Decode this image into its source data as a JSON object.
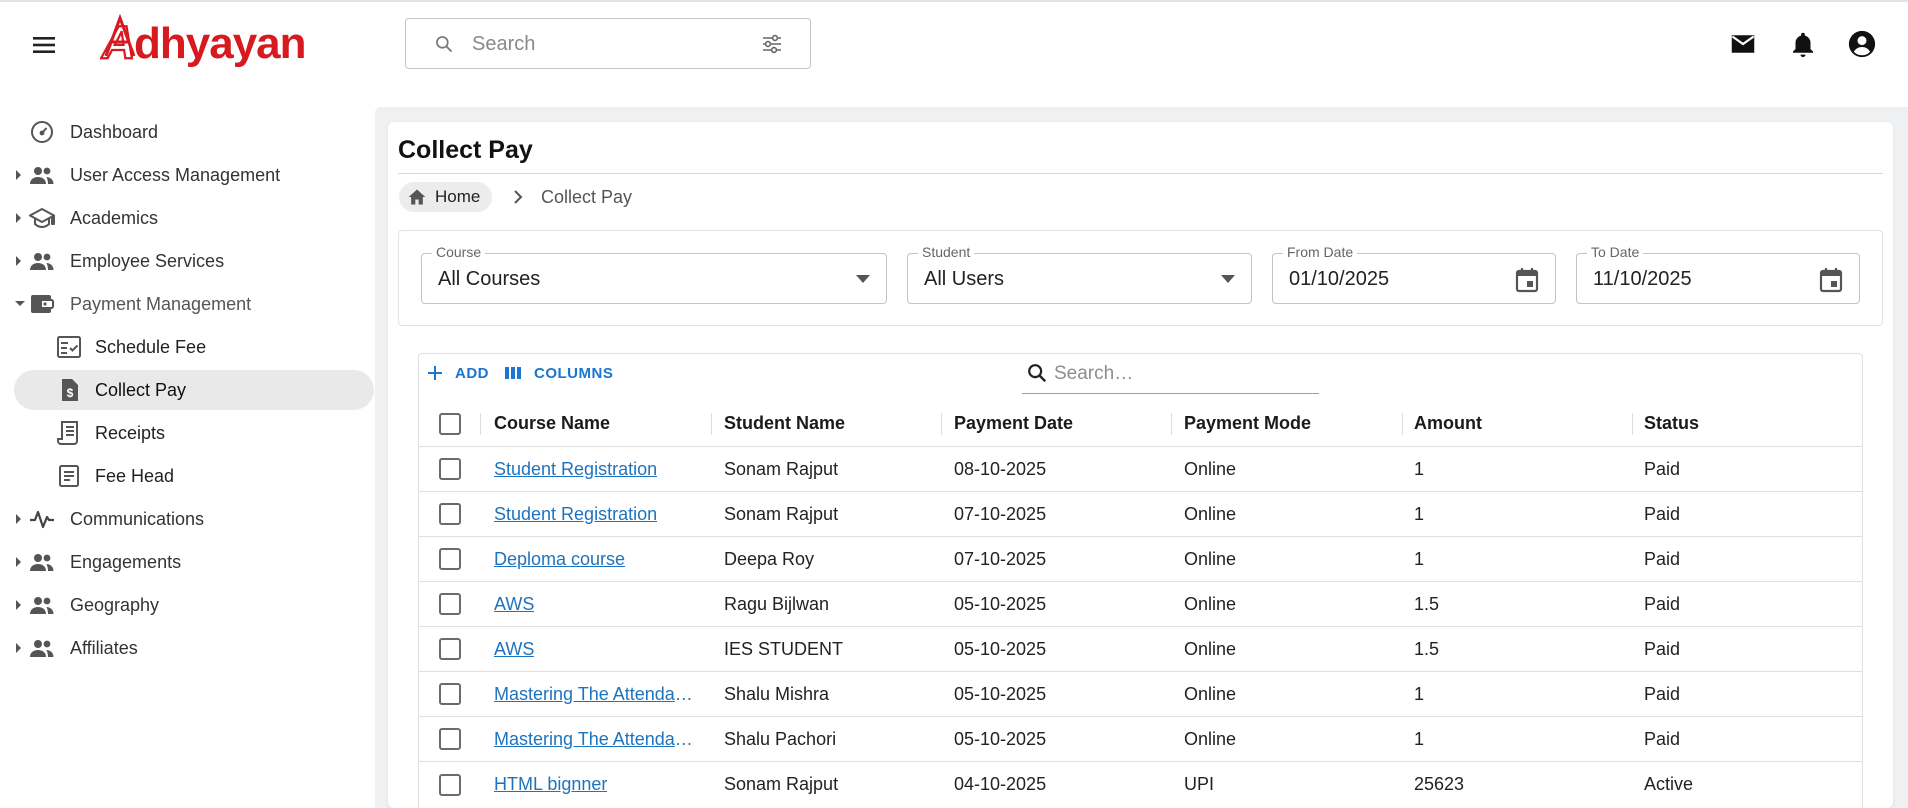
{
  "app": {
    "logo_text": "Adhyayan",
    "brand_color": "#d71920"
  },
  "topbar": {
    "search": {
      "placeholder": "Search"
    },
    "icons": [
      "menu-icon",
      "search-icon",
      "tune-icon",
      "mail-icon",
      "bell-icon",
      "account-icon"
    ]
  },
  "sidebar": {
    "items": [
      {
        "label": "Dashboard",
        "icon": "dashboard-icon",
        "expandable": false
      },
      {
        "label": "User Access Management",
        "icon": "people-icon",
        "expandable": true
      },
      {
        "label": "Academics",
        "icon": "school-icon",
        "expandable": true
      },
      {
        "label": "Employee Services",
        "icon": "people-icon",
        "expandable": true
      },
      {
        "label": "Payment Management",
        "icon": "wallet-icon",
        "expandable": true,
        "expanded": true
      },
      {
        "label": "Schedule Fee",
        "icon": "checklist-icon",
        "sub": true
      },
      {
        "label": "Collect Pay",
        "icon": "invoice-icon",
        "sub": true,
        "active": true
      },
      {
        "label": "Receipts",
        "icon": "receipt-icon",
        "sub": true
      },
      {
        "label": "Fee Head",
        "icon": "list-icon",
        "sub": true
      },
      {
        "label": "Communications",
        "icon": "pulse-icon",
        "expandable": true
      },
      {
        "label": "Engagements",
        "icon": "people-icon",
        "expandable": true
      },
      {
        "label": "Geography",
        "icon": "people-icon",
        "expandable": true
      },
      {
        "label": "Affiliates",
        "icon": "people-icon",
        "expandable": true
      }
    ]
  },
  "page": {
    "title": "Collect Pay",
    "breadcrumb": {
      "home": "Home",
      "current": "Collect Pay"
    }
  },
  "filters": {
    "course": {
      "label": "Course",
      "value": "All Courses"
    },
    "student": {
      "label": "Student",
      "value": "All Users"
    },
    "from_date": {
      "label": "From Date",
      "value": "01/10/2025"
    },
    "to_date": {
      "label": "To Date",
      "value": "11/10/2025"
    }
  },
  "grid": {
    "add_label": "ADD",
    "columns_label": "COLUMNS",
    "search_placeholder": "Search…",
    "headers": [
      "Course Name",
      "Student Name",
      "Payment Date",
      "Payment Mode",
      "Amount",
      "Status"
    ],
    "rows": [
      {
        "course": "Student Registration",
        "student": "Sonam Rajput",
        "date": "08-10-2025",
        "mode": "Online",
        "amount": "1",
        "status": "Paid"
      },
      {
        "course": "Student Registration",
        "student": "Sonam Rajput",
        "date": "07-10-2025",
        "mode": "Online",
        "amount": "1",
        "status": "Paid"
      },
      {
        "course": "Deploma course",
        "student": "Deepa Roy",
        "date": "07-10-2025",
        "mode": "Online",
        "amount": "1",
        "status": "Paid"
      },
      {
        "course": "AWS",
        "student": "Ragu Bijlwan",
        "date": "05-10-2025",
        "mode": "Online",
        "amount": "1.5",
        "status": "Paid"
      },
      {
        "course": "AWS",
        "student": "IES STUDENT",
        "date": "05-10-2025",
        "mode": "Online",
        "amount": "1.5",
        "status": "Paid"
      },
      {
        "course": "Mastering The Attendance Register",
        "student": "Shalu Mishra",
        "date": "05-10-2025",
        "mode": "Online",
        "amount": "1",
        "status": "Paid"
      },
      {
        "course": "Mastering The Attendance Register",
        "student": "Shalu Pachori",
        "date": "05-10-2025",
        "mode": "Online",
        "amount": "1",
        "status": "Paid"
      },
      {
        "course": "HTML bignner",
        "student": "Sonam Rajput",
        "date": "04-10-2025",
        "mode": "UPI",
        "amount": "25623",
        "status": "Active"
      }
    ]
  }
}
